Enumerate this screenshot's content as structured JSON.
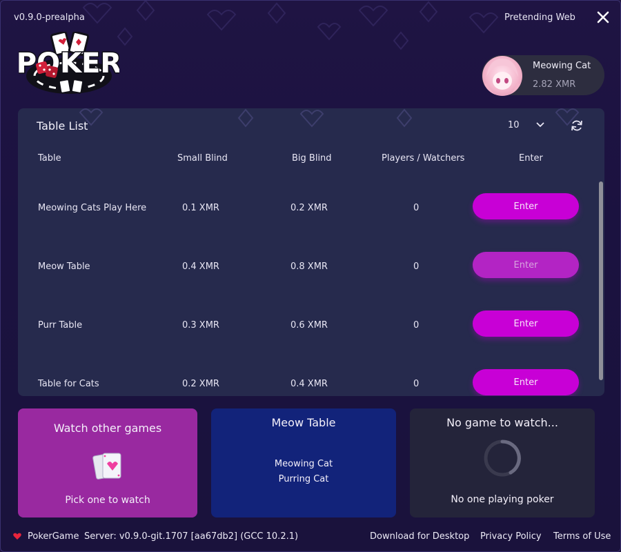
{
  "header": {
    "version": "v0.9.0-prealpha",
    "mode": "Pretending Web"
  },
  "logo": {
    "text": "POKER"
  },
  "user": {
    "name": "Meowing Cat",
    "balance": "2.82 XMR"
  },
  "table_list": {
    "title": "Table List",
    "per_page": "10",
    "columns": [
      "Table",
      "Small Blind",
      "Big Blind",
      "Players / Watchers",
      "Enter"
    ],
    "rows": [
      {
        "name": "Meowing Cats Play Here",
        "small_blind": "0.1 XMR",
        "big_blind": "0.2 XMR",
        "players": "0",
        "button": "Enter",
        "enabled": true
      },
      {
        "name": "Meow Table",
        "small_blind": "0.4 XMR",
        "big_blind": "0.8 XMR",
        "players": "0",
        "button": "Enter",
        "enabled": false
      },
      {
        "name": "Purr Table",
        "small_blind": "0.3 XMR",
        "big_blind": "0.6 XMR",
        "players": "0",
        "button": "Enter",
        "enabled": true
      },
      {
        "name": "Table for Cats",
        "small_blind": "0.2 XMR",
        "big_blind": "0.4 XMR",
        "players": "0",
        "button": "Enter",
        "enabled": true
      }
    ]
  },
  "cards": {
    "watch": {
      "title": "Watch other games",
      "subtitle": "Pick one to watch"
    },
    "meow": {
      "title": "Meow Table",
      "players": [
        "Meowing Cat",
        "Purring Cat"
      ]
    },
    "none": {
      "title": "No game to watch...",
      "subtitle": "No one playing poker"
    }
  },
  "footer": {
    "app_name": "PokerGame",
    "server": "Server: v0.9.0-git.1707 [aa67db2] (GCC 10.2.1)",
    "links": [
      "Download for Desktop",
      "Privacy Policy",
      "Terms of Use"
    ]
  },
  "colors": {
    "accent": "#c800d6",
    "watch_card": "#9929a0",
    "meow_card": "#12237a",
    "none_card": "#24243a",
    "panel": "#262a4d"
  }
}
